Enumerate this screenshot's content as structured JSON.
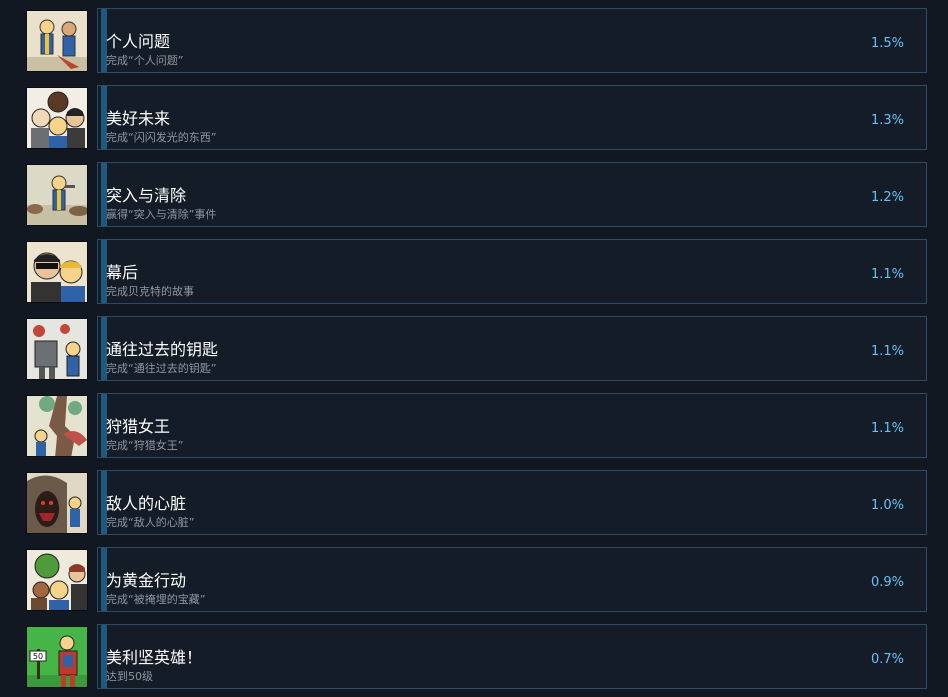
{
  "achievements": [
    {
      "title": "个人问题",
      "description": "完成“个人问题”",
      "percent": "1.5%",
      "icon": "vault-boys-fighting-icon",
      "bg": "#e9e1cc"
    },
    {
      "title": "美好未来",
      "description": "完成“闪闪发光的东西”",
      "percent": "1.3%",
      "icon": "group-portrait-icon",
      "bg": "#f2eee6"
    },
    {
      "title": "突入与清除",
      "description": "赢得“突入与清除”事件",
      "percent": "1.2%",
      "icon": "vault-boy-wasteland-icon",
      "bg": "#dcd9c7"
    },
    {
      "title": "幕后",
      "description": "完成贝克特的故事",
      "percent": "1.1%",
      "icon": "sunglasses-portrait-icon",
      "bg": "#ece4cf"
    },
    {
      "title": "通往过去的钥匙",
      "description": "完成“通往过去的钥匙”",
      "percent": "1.1%",
      "icon": "robot-battle-icon",
      "bg": "#e6e6e0"
    },
    {
      "title": "狩猎女王",
      "description": "完成“狩猎女王”",
      "percent": "1.1%",
      "icon": "queen-hunt-icon",
      "bg": "#e6e2d0"
    },
    {
      "title": "敌人的心脏",
      "description": "完成“敌人的心脏”",
      "percent": "1.0%",
      "icon": "cave-monster-icon",
      "bg": "#ded8c5"
    },
    {
      "title": "为黄金行动",
      "description": "完成“被掩埋的宝藏”",
      "percent": "0.9%",
      "icon": "gold-crew-icon",
      "bg": "#f0eadc"
    },
    {
      "title": "美利坚英雄！",
      "description": "达到50级",
      "percent": "0.7%",
      "icon": "american-hero-icon",
      "bg": "#46b548"
    }
  ]
}
